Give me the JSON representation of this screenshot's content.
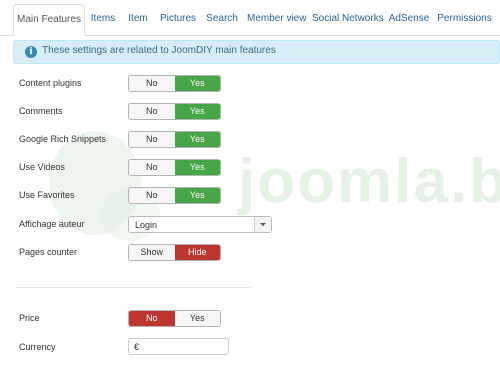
{
  "watermark": "joomla.bid",
  "tabs": [
    "Main Features",
    "Items",
    "Item",
    "Pictures",
    "Search",
    "Member view",
    "Social Networks",
    "AdSense",
    "Permissions"
  ],
  "active_tab": "Main Features",
  "alert": {
    "icon": "info-icon",
    "icon_glyph": "i",
    "text": "These settings are related to JoomDIY main features"
  },
  "settings": {
    "content_plugins": {
      "label": "Content plugins",
      "options": [
        "No",
        "Yes"
      ],
      "selected": "Yes"
    },
    "comments": {
      "label": "Comments",
      "options": [
        "No",
        "Yes"
      ],
      "selected": "Yes"
    },
    "google_rich_snippets": {
      "label": "Google Rich Snippets",
      "options": [
        "No",
        "Yes"
      ],
      "selected": "Yes"
    },
    "use_videos": {
      "label": "Use Videos",
      "options": [
        "No",
        "Yes"
      ],
      "selected": "Yes"
    },
    "use_favorites": {
      "label": "Use Favorites",
      "options": [
        "No",
        "Yes"
      ],
      "selected": "Yes"
    },
    "affichage_auteur": {
      "label": "Affichage auteur",
      "value": "Login"
    },
    "pages_counter": {
      "label": "Pages counter",
      "options": [
        "Show",
        "Hide"
      ],
      "selected": "Hide"
    },
    "price": {
      "label": "Price",
      "options": [
        "No",
        "Yes"
      ],
      "selected": "No"
    },
    "currency": {
      "label": "Currency",
      "value": "€"
    }
  },
  "colors": {
    "on_green": "#46a546",
    "on_red": "#bd362f",
    "off": "#f6f6f6",
    "link": "#2a6496",
    "alert_bg": "#d9edf7"
  }
}
